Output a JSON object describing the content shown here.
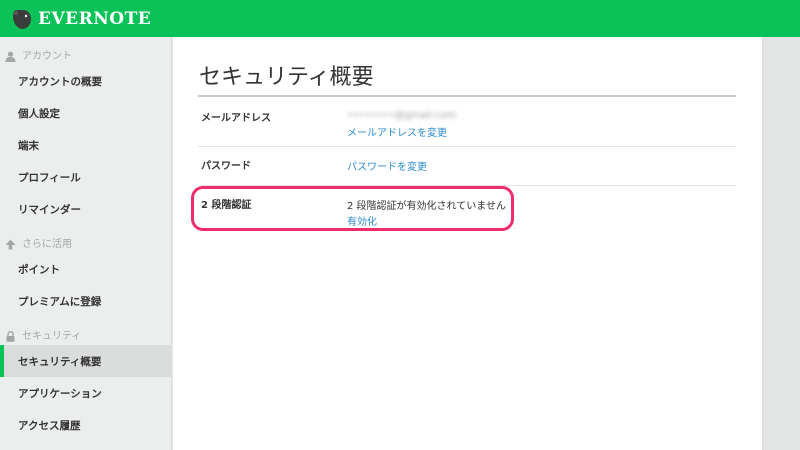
{
  "app": {
    "brand": "EVERNOTE",
    "brand_color": "#0bc259",
    "logo_icon": "elephant-icon"
  },
  "sidebar": {
    "sections": [
      {
        "header": "アカウント",
        "icon": "person-icon",
        "items": [
          {
            "label": "アカウントの概要"
          },
          {
            "label": "個人設定"
          },
          {
            "label": "端末"
          },
          {
            "label": "プロフィール"
          },
          {
            "label": "リマインダー"
          }
        ]
      },
      {
        "header": "さらに活用",
        "icon": "arrow-up-icon",
        "items": [
          {
            "label": "ポイント"
          },
          {
            "label": "プレミアムに登録"
          }
        ]
      },
      {
        "header": "セキュリティ",
        "icon": "lock-icon",
        "items": [
          {
            "label": "セキュリティ概要",
            "active": true
          },
          {
            "label": "アプリケーション"
          },
          {
            "label": "アクセス履歴"
          }
        ]
      }
    ]
  },
  "main": {
    "title": "セキュリティ概要",
    "rows": {
      "email": {
        "label": "メールアドレス",
        "value": "••••••••@gmail.com",
        "link": "メールアドレスを変更"
      },
      "password": {
        "label": "パスワード",
        "link": "パスワードを変更"
      },
      "two_step": {
        "label": "2 段階認証",
        "value": "2 段階認証が有効化されていません",
        "link": "有効化"
      }
    }
  },
  "colors": {
    "link": "#2d8ccf",
    "highlight": "#ee2d6b",
    "active_indicator": "#0bc259"
  }
}
